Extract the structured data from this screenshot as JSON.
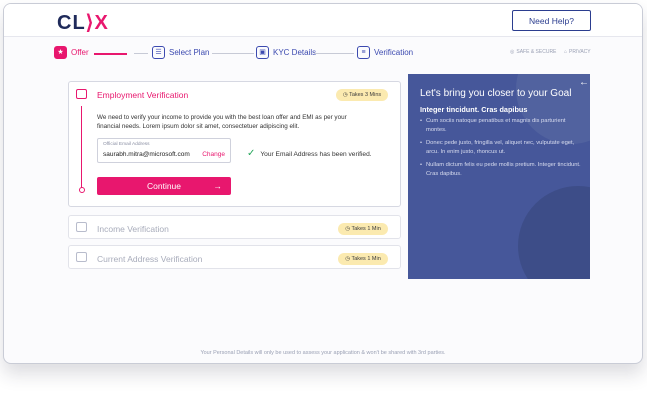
{
  "header": {
    "logo_main": "CL",
    "logo_accent": "X",
    "logo_mid": "⟩",
    "help_label": "Need Help?"
  },
  "steps": [
    {
      "label": "Offer",
      "icon": "gift-icon",
      "active": true
    },
    {
      "label": "Select Plan",
      "icon": "plan-icon",
      "active": false
    },
    {
      "label": "KYC Details",
      "icon": "id-card-icon",
      "active": false
    },
    {
      "label": "Verification",
      "icon": "document-icon",
      "active": false
    }
  ],
  "trust": {
    "safe": "SAFE & SECURE",
    "privacy": "PRIVACY"
  },
  "employment": {
    "title": "Employment Verification",
    "badge": "Takes 3 Mins",
    "description": "We need to verify your income to provide you with the best loan offer and EMI as per your financial needs. Lorem ipsum dolor sit amet, consectetuer adipiscing elit.",
    "email_label": "Official Email Address",
    "email_value": "saurabh.mitra@microsoft.com",
    "change_label": "Change",
    "verified_text": "Your Email Address has been verified.",
    "continue_label": "Continue"
  },
  "income": {
    "title": "Income Verification",
    "badge": "Takes 1 Min"
  },
  "address": {
    "title": "Current Address Verification",
    "badge": "Takes 1 Min"
  },
  "promo": {
    "heading": "Let's bring you closer to your Goal",
    "subheading": "Integer tincidunt. Cras dapibus",
    "bullets": [
      "Cum sociis natoque penatibus et magnis dis parturient montes.",
      "Donec pede justo, fringilla vel, aliquet nec, vulputate eget, arcu. In enim justo, rhoncus ut.",
      "Nullam dictum felis eu pede mollis pretium. Integer tincidunt. Cras dapibus."
    ]
  },
  "footer": "Your Personal Details will only be used to assess your application & won't be shared with 3rd parties.",
  "colors": {
    "brand": "#e8176e",
    "primary": "#2b3d8f",
    "panel": "#46579a",
    "badge": "#fbeab0"
  }
}
